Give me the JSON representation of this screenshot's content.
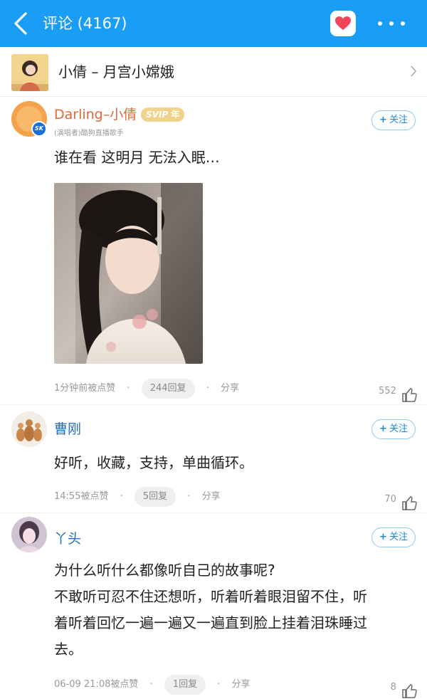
{
  "header": {
    "title": "评论 (4167)"
  },
  "song": {
    "title": "小倩 – 月宫小嫦娥"
  },
  "comments": [
    {
      "username": "Darling–小倩",
      "vip_badge": "SVIP",
      "vip_suffix": "年",
      "verified_badge": "SK",
      "subtitle": "(演唱者)酷狗直播歌手",
      "follow_label": "关注",
      "text": "谁在看 这明月 无法入眠…",
      "time": "1分钟前被点赞",
      "replies": "244回复",
      "share": "分享",
      "likes": "552"
    },
    {
      "username": "曹刚",
      "follow_label": "关注",
      "text": "好听，收藏，支持，单曲循环。",
      "time": "14:55被点赞",
      "replies": "5回复",
      "share": "分享",
      "likes": "70"
    },
    {
      "username": "丫头",
      "follow_label": "关注",
      "text_lines": [
        "为什么听什么都像听自己的故事呢?",
        "不敢听可忍不住还想听，听着听着眼泪留不住，听",
        "着听着回忆一遍一遍又一遍直到脸上挂着泪珠睡过",
        "去。"
      ],
      "time": "06-09 21:08被点赞",
      "replies": "1回复",
      "share": "分享",
      "likes": "8"
    }
  ],
  "icons": {
    "back": "chevron-left-icon",
    "heart": "heart-icon",
    "more": "more-icon",
    "arrow": "chevron-right-icon",
    "thumb": "thumb-up-icon"
  },
  "colors": {
    "header_bg": "#1a9df5",
    "username_orange": "#e0683a",
    "username_blue": "#2b6cb8",
    "vip_gold": "#e2b24a",
    "heart_red": "#f0455a"
  }
}
